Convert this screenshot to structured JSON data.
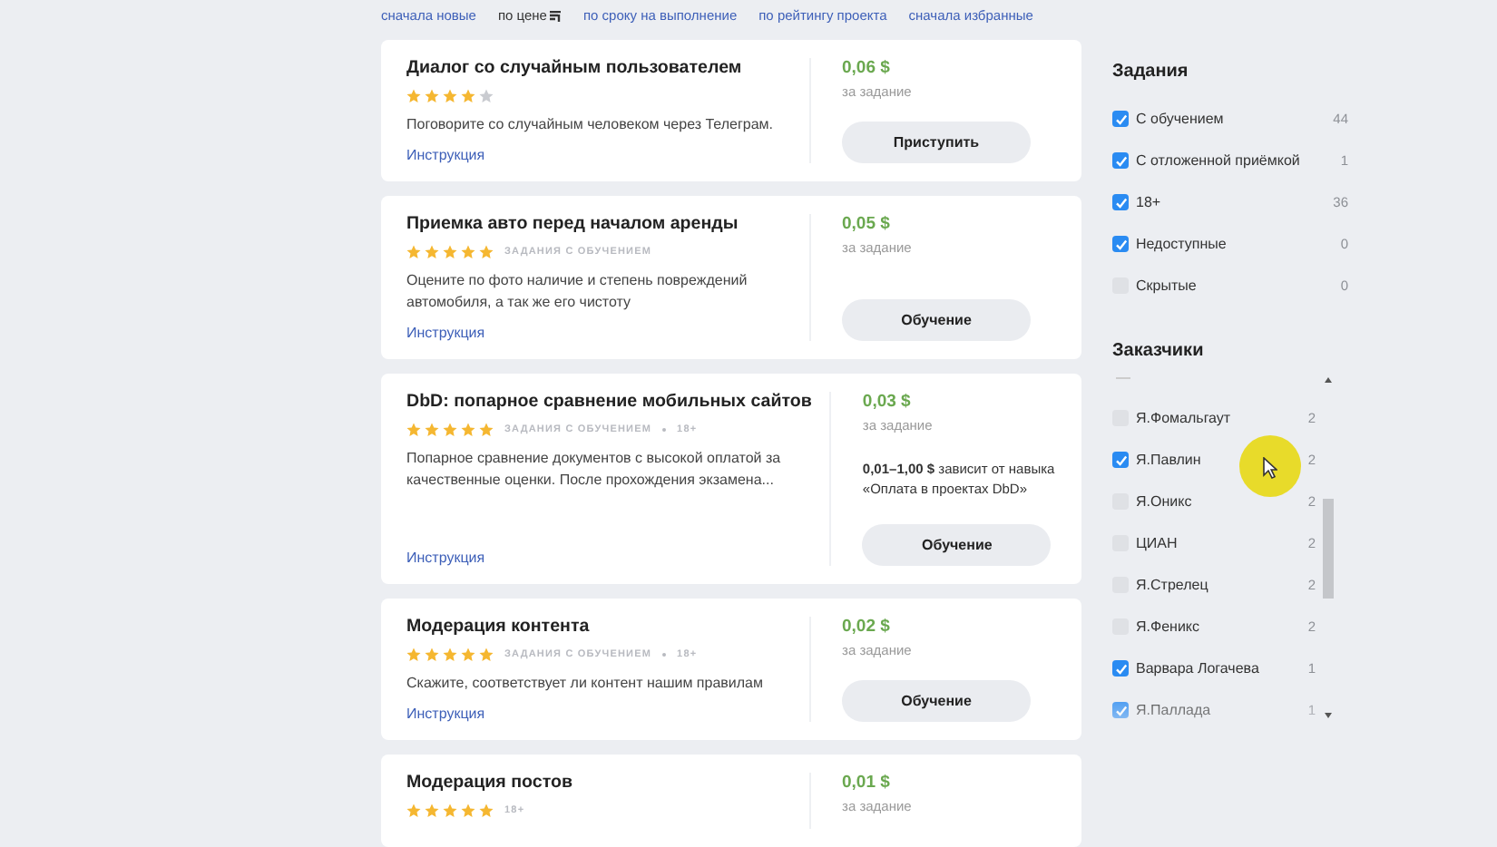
{
  "sort_options": [
    {
      "label": "сначала новые",
      "selected": false
    },
    {
      "label": "по цене",
      "selected": true
    },
    {
      "label": "по сроку на выполнение",
      "selected": false
    },
    {
      "label": "по рейтингу проекта",
      "selected": false
    },
    {
      "label": "сначала избранные",
      "selected": false
    }
  ],
  "cards": [
    {
      "title": "Диалог со случайным пользователем",
      "stars": 4,
      "description": "Поговорите со случайным человеком через Телеграм.",
      "link": "Инструкция",
      "price": "0,06 $",
      "price_unit": "за задание",
      "button": "Приступить"
    },
    {
      "title": "Приемка авто перед началом аренды",
      "stars": 5,
      "tags": [
        "ЗАДАНИЯ С ОБУЧЕНИЕМ"
      ],
      "description": "Оцените по фото наличие и степень повреждений автомобиля, а так же его чистоту",
      "link": "Инструкция",
      "price": "0,05 $",
      "price_unit": "за задание",
      "button": "Обучение"
    },
    {
      "title": "DbD: попарное сравнение мобильных сайтов",
      "stars": 5,
      "tags": [
        "ЗАДАНИЯ С ОБУЧЕНИЕМ",
        "18+"
      ],
      "description": "Попарное сравнение документов с высокой оплатой за качественные оценки. После прохождения экзамена...",
      "link": "Инструкция",
      "price": "0,03 $",
      "price_unit": "за задание",
      "payment_note": "**0,01–1,00 $** зависит от навыка «Оплата в проектах DbD»",
      "button": "Обучение"
    },
    {
      "title": "Модерация контента",
      "stars": 5,
      "tags": [
        "ЗАДАНИЯ С ОБУЧЕНИЕМ",
        "18+"
      ],
      "description": "Скажите, соответствует ли контент нашим правилам",
      "link": "Инструкция",
      "price": "0,02 $",
      "price_unit": "за задание",
      "button": "Обучение"
    },
    {
      "title": "Модерация постов",
      "stars": 5,
      "tags": [
        "18+"
      ],
      "price": "0,01 $",
      "price_unit": "за задание"
    }
  ],
  "sidebar": {
    "tasks_title": "Задания",
    "task_filters": [
      {
        "label": "С обучением",
        "count": "44",
        "checked": true
      },
      {
        "label": "С отложенной приёмкой",
        "count": "1",
        "checked": true
      },
      {
        "label": "18+",
        "count": "36",
        "checked": true
      },
      {
        "label": "Недоступные",
        "count": "0",
        "checked": true
      },
      {
        "label": "Скрытые",
        "count": "0",
        "checked": false
      }
    ],
    "customers_title": "Заказчики",
    "customers": [
      {
        "label": "Я.Фомальгаут",
        "count": "2",
        "checked": false
      },
      {
        "label": "Я.Павлин",
        "count": "2",
        "checked": true
      },
      {
        "label": "Я.Оникс",
        "count": "2",
        "checked": false
      },
      {
        "label": "ЦИАН",
        "count": "2",
        "checked": false
      },
      {
        "label": "Я.Стрелец",
        "count": "2",
        "checked": false
      },
      {
        "label": "Я.Феникс",
        "count": "2",
        "checked": false
      },
      {
        "label": "Варвара Логачева",
        "count": "1",
        "checked": true
      },
      {
        "label": "Я.Паллада",
        "count": "1",
        "checked": true
      }
    ]
  }
}
